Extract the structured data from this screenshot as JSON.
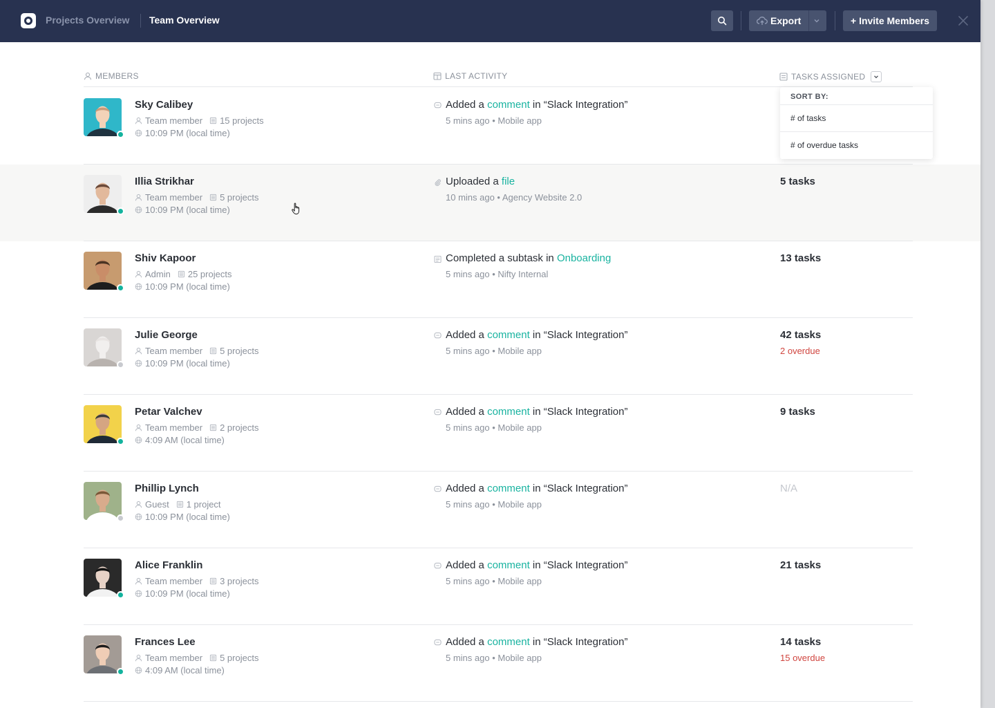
{
  "header": {
    "breadcrumb": [
      "Projects Overview",
      "Team Overview"
    ],
    "export_label": "Export",
    "invite_label": "+ Invite Members"
  },
  "columns": {
    "members": "MEMBERS",
    "last_activity": "LAST ACTIVITY",
    "tasks_assigned": "TASKS ASSIGNED"
  },
  "sort_menu": {
    "title": "SORT BY:",
    "options": [
      "# of tasks",
      "# of overdue tasks"
    ]
  },
  "colors": {
    "accent": "#19b3a0",
    "overdue": "#d0453f",
    "online": "#13b39e",
    "offline": "#c8cacf",
    "topbar": "#283250"
  },
  "members": [
    {
      "name": "Sky Calibey",
      "role": "Team member",
      "projects": "15 projects",
      "time": "10:09 PM (local time)",
      "status": "online",
      "activity_icon": "comment-icon",
      "activity_pre": "Added a",
      "activity_link": "comment",
      "activity_post": "in “Slack Integration”",
      "activity_sub": "5 mins ago • Mobile app",
      "tasks": "",
      "overdue": ""
    },
    {
      "name": "Illia Strikhar",
      "role": "Team member",
      "projects": "5 projects",
      "time": "10:09 PM (local time)",
      "status": "online",
      "activity_icon": "paperclip-icon",
      "activity_pre": "Uploaded a",
      "activity_link": "file",
      "activity_post": "",
      "activity_sub": "10 mins ago • Agency Website 2.0",
      "tasks": "5 tasks",
      "overdue": ""
    },
    {
      "name": "Shiv Kapoor",
      "role": "Admin",
      "projects": "25 projects",
      "time": "10:09 PM (local time)",
      "status": "online",
      "activity_icon": "checklist-icon",
      "activity_pre": "Completed a subtask in",
      "activity_link": "Onboarding",
      "activity_post": "",
      "activity_sub": "5 mins ago • Nifty Internal",
      "tasks": "13 tasks",
      "overdue": ""
    },
    {
      "name": "Julie George",
      "role": "Team member",
      "projects": "5 projects",
      "time": "10:09 PM (local time)",
      "status": "offline",
      "activity_icon": "comment-icon",
      "activity_pre": "Added a",
      "activity_link": "comment",
      "activity_post": "in “Slack Integration”",
      "activity_sub": "5 mins ago • Mobile app",
      "tasks": "42 tasks",
      "overdue": "2 overdue"
    },
    {
      "name": "Petar Valchev",
      "role": "Team member",
      "projects": "2 projects",
      "time": "4:09 AM (local time)",
      "status": "online",
      "activity_icon": "comment-icon",
      "activity_pre": "Added a",
      "activity_link": "comment",
      "activity_post": "in “Slack Integration”",
      "activity_sub": "5 mins ago • Mobile app",
      "tasks": "9 tasks",
      "overdue": ""
    },
    {
      "name": "Phillip Lynch",
      "role": "Guest",
      "projects": "1 project",
      "time": "10:09 PM (local time)",
      "status": "offline",
      "activity_icon": "comment-icon",
      "activity_pre": "Added a",
      "activity_link": "comment",
      "activity_post": "in “Slack Integration”",
      "activity_sub": "5 mins ago • Mobile app",
      "tasks": "N/A",
      "overdue": ""
    },
    {
      "name": "Alice Franklin",
      "role": "Team member",
      "projects": "3 projects",
      "time": "10:09 PM (local time)",
      "status": "online",
      "activity_icon": "comment-icon",
      "activity_pre": "Added a",
      "activity_link": "comment",
      "activity_post": "in “Slack Integration”",
      "activity_sub": "5 mins ago • Mobile app",
      "tasks": "21 tasks",
      "overdue": ""
    },
    {
      "name": "Frances Lee",
      "role": "Team member",
      "projects": "5 projects",
      "time": "4:09 AM (local time)",
      "status": "online",
      "activity_icon": "comment-icon",
      "activity_pre": "Added a",
      "activity_link": "comment",
      "activity_post": "in “Slack Integration”",
      "activity_sub": "5 mins ago • Mobile app",
      "tasks": "14 tasks",
      "overdue": "15 overdue"
    }
  ]
}
